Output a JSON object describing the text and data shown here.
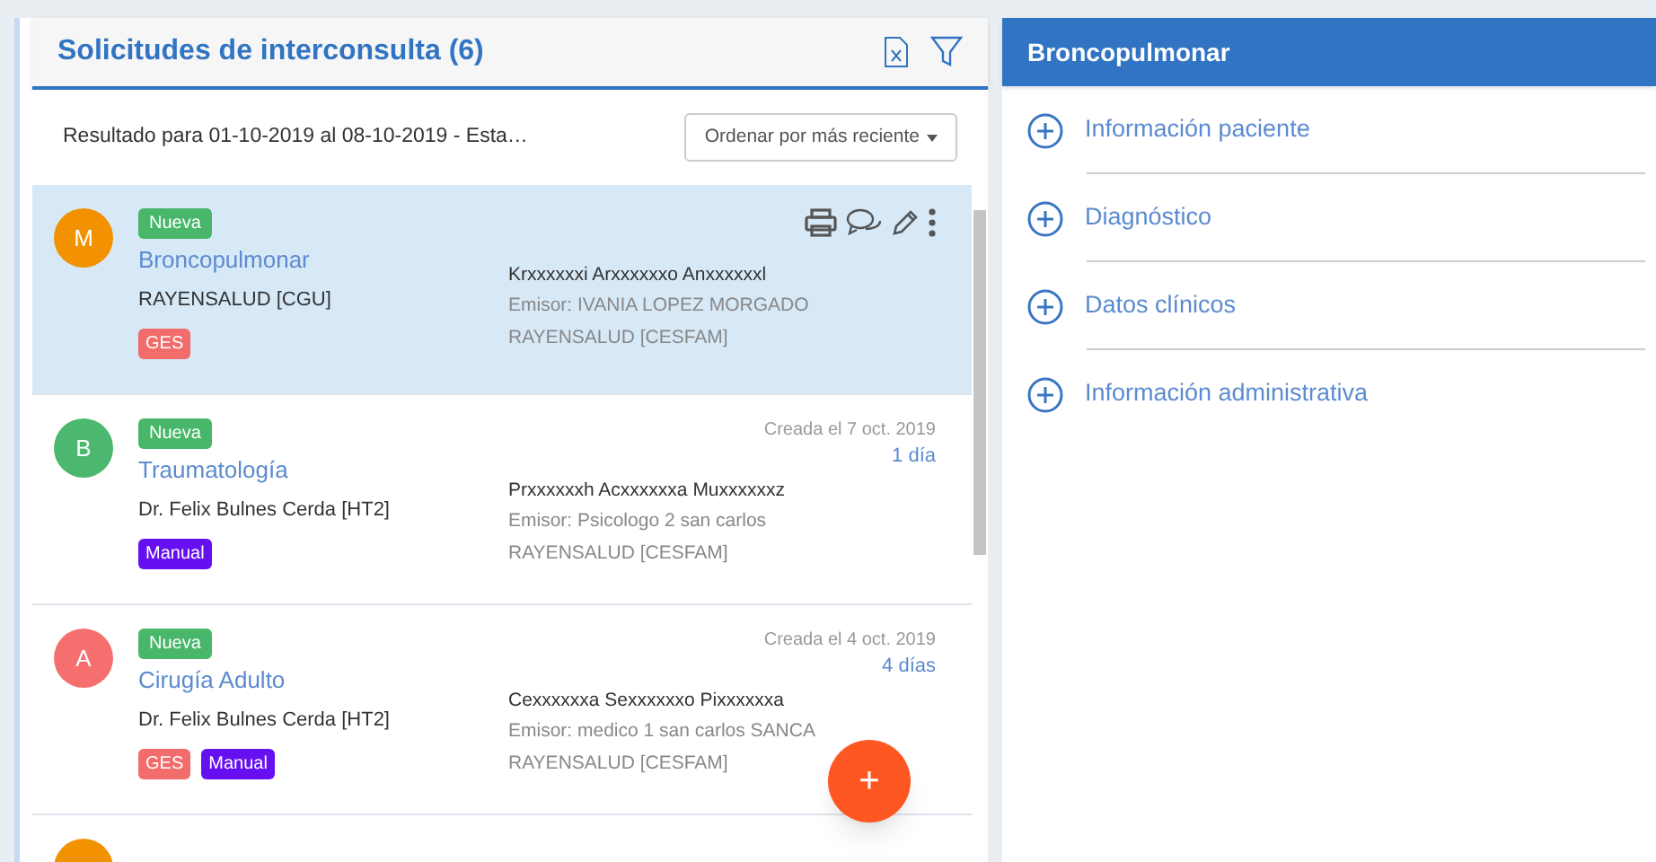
{
  "list_panel": {
    "title": "Solicitudes de interconsulta (6)",
    "result_text": "Resultado para 01-10-2019 al 08-10-2019 - Esta…",
    "sort_button": "Ordenar por más reciente",
    "cards": [
      {
        "initial": "M",
        "color": "#f39200",
        "selected": true,
        "status": "Nueva",
        "specialty": "Broncopulmonar",
        "professional": "RAYENSALUD [CGU]",
        "tags": [
          {
            "label": "GES",
            "color": "#f26c6c"
          }
        ],
        "patient": "Krxxxxxxi Arxxxxxxo Anxxxxxxl",
        "emitter": "Emisor: IVANIA LOPEZ MORGADO",
        "origin": "RAYENSALUD [CESFAM]"
      },
      {
        "initial": "B",
        "color": "#4cb86f",
        "selected": false,
        "status": "Nueva",
        "specialty": "Traumatología",
        "professional": "Dr. Felix Bulnes Cerda [HT2]",
        "tags": [
          {
            "label": "Manual",
            "color": "#6610f2"
          }
        ],
        "created": "Creada el 7 oct. 2019",
        "age": "1 día",
        "patient": "Prxxxxxxh Acxxxxxxa Muxxxxxxz",
        "emitter": "Emisor: Psicologo 2 san carlos",
        "origin": "RAYENSALUD [CESFAM]"
      },
      {
        "initial": "A",
        "color": "#f56f6f",
        "selected": false,
        "status": "Nueva",
        "specialty": "Cirugía Adulto",
        "professional": "Dr. Felix Bulnes Cerda [HT2]",
        "tags": [
          {
            "label": "GES",
            "color": "#f26c6c"
          },
          {
            "label": "Manual",
            "color": "#6610f2"
          }
        ],
        "created": "Creada el 4 oct. 2019",
        "age": "4 días",
        "patient": "Cexxxxxxa Sexxxxxxo Pixxxxxxa",
        "emitter": "Emisor: medico 1 san carlos SANCA",
        "origin": "RAYENSALUD [CESFAM]"
      },
      {
        "color": "#f39200",
        "selected": false
      }
    ],
    "fab": "+"
  },
  "detail_panel": {
    "title": "Broncopulmonar",
    "sections": [
      {
        "label": "Información paciente",
        "expanded": false
      },
      {
        "label": "Diagnóstico",
        "expanded": false
      },
      {
        "label": "Datos clínicos",
        "expanded": false
      },
      {
        "label": "Información administrativa",
        "expanded": false
      }
    ]
  }
}
